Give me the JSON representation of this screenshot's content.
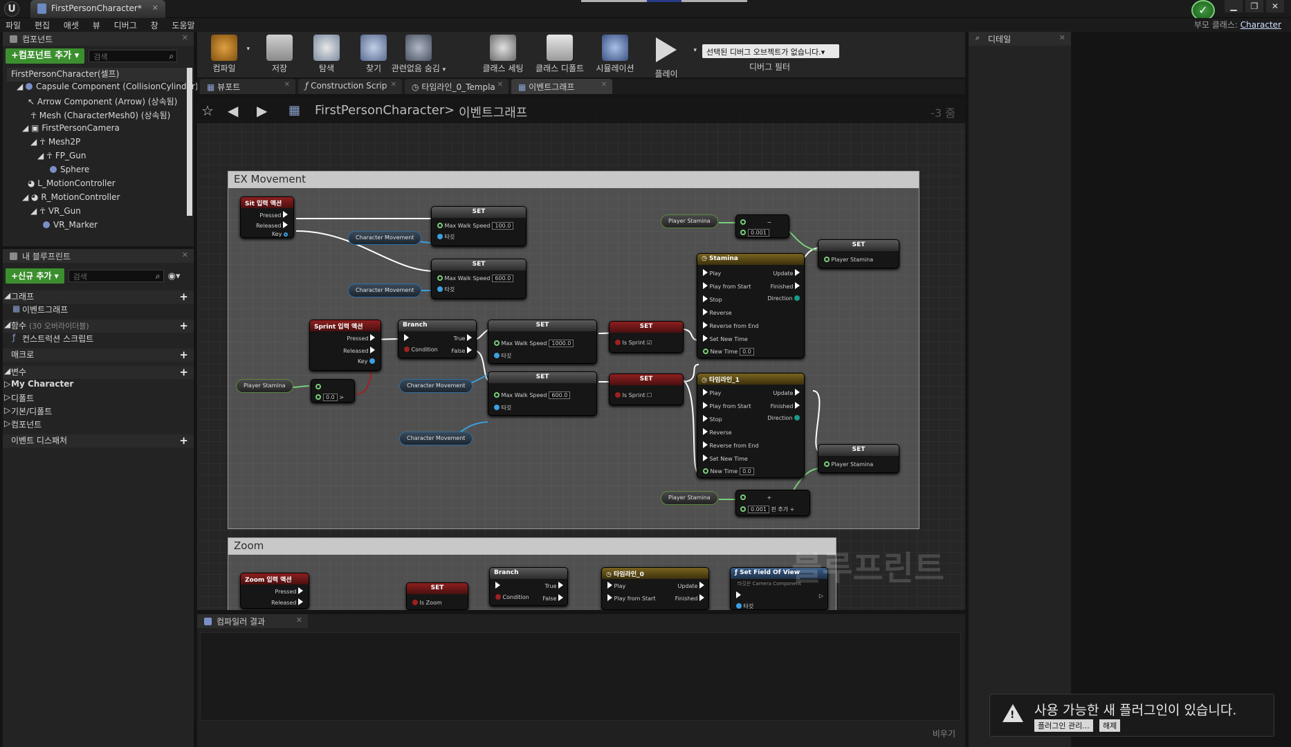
{
  "window": {
    "doc_tab": "FirstPersonCharacter*",
    "parent_class_label": "부모 클래스:",
    "parent_class_value": "Character"
  },
  "menu": [
    "파일",
    "편집",
    "애셋",
    "뷰",
    "디버그",
    "창",
    "도움말"
  ],
  "components": {
    "title": "컴포넌트",
    "add_button": "+컴포넌트 추가 ▾",
    "search_placeholder": "검색",
    "items": [
      "FirstPersonCharacter(셀프)",
      "Capsule Component (CollisionCylinder)",
      "Arrow Component (Arrow) (상속됨)",
      "Mesh (CharacterMesh0) (상속됨)",
      "FirstPersonCamera",
      "Mesh2P",
      "FP_Gun",
      "Sphere",
      "L_MotionController",
      "R_MotionController",
      "VR_Gun",
      "VR_Marker"
    ]
  },
  "my_blueprint": {
    "title": "내 블루프린트",
    "add_button": "+신규 추가 ▾",
    "search_placeholder": "검색",
    "graph_section": "그래프",
    "event_graph": "이벤트그래프",
    "functions_section": "함수",
    "functions_overridable": "(30 오버라이더블)",
    "construction_script": "컨스트럭션 스크립트",
    "macros_section": "매크로",
    "variables_section": "변수",
    "var_categories": [
      "My Character",
      "디폴트",
      "기본/디폴트",
      "컴포넌트"
    ],
    "event_dispatchers": "이벤트 디스패처"
  },
  "toolbar": {
    "compile": "컴파일",
    "save": "저장",
    "browse": "탐색",
    "find": "찾기",
    "hide_unrelated": "관련없음 숨김",
    "class_settings": "클래스 세팅",
    "class_defaults": "클래스 디폴트",
    "simulation": "시뮬레이션",
    "play": "플레이",
    "debug_object": "선택된 디버그 오브젝트가 없습니다.▾",
    "debug_filter": "디버그 필터"
  },
  "editor_tabs": [
    "뷰포트",
    "Construction Scrip",
    "타임라인_0_Templa",
    "이벤트그래프"
  ],
  "breadcrumb": {
    "root": "FirstPersonCharacter",
    "sep": ">",
    "current": "이벤트그래프",
    "zoom": "-3 줌"
  },
  "graph": {
    "comment1": "EX Movement",
    "comment2": "Zoom",
    "watermark": "블루프린트",
    "sit_event": "Sit 입력 액션",
    "sprint_event": "Sprint 입력 액션",
    "zoom_event": "Zoom 입력 액션",
    "pressed": "Pressed",
    "released": "Released",
    "key": "Key",
    "set": "SET",
    "branch": "Branch",
    "true": "True",
    "false": "False",
    "condition": "Condition",
    "max_walk_speed": "Max Walk Speed",
    "target": "타깃",
    "char_movement": "Character Movement",
    "player_stamina": "Player Stamina",
    "is_sprint": "Is Sprint",
    "is_zoom": "Is Zoom",
    "stamina_tl": "Stamina",
    "timeline1": "타임라인_1",
    "timeline0": "타임라인_0",
    "set_fov": "Set Field Of View",
    "set_fov_sub": "타깃은 Camera Component",
    "play": "Play",
    "play_from_start": "Play from Start",
    "stop": "Stop",
    "reverse": "Reverse",
    "reverse_from_end": "Reverse from End",
    "set_new_time": "Set New Time",
    "new_time": "New Time",
    "update": "Update",
    "finished": "Finished",
    "direction": "Direction",
    "v100": "100.0",
    "v600": "600.0",
    "v1000": "1000.0",
    "v0": "0.0",
    "v0001": "0.001",
    "add_pin": "핀 추가"
  },
  "compiler": {
    "title": "컴파일러 결과",
    "clear": "비우기"
  },
  "details": {
    "title": "디테일"
  },
  "notification": {
    "message": "사용 가능한 새 플러그인이 있습니다.",
    "manage": "플러그인 관리...",
    "dismiss": "해제"
  }
}
